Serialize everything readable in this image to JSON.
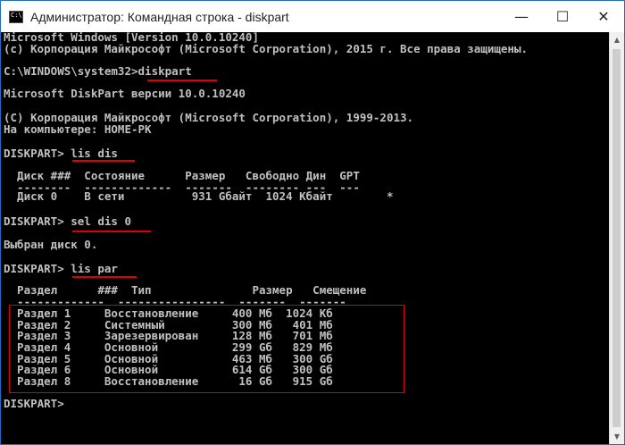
{
  "window": {
    "title": "Администратор: Командная строка - diskpart",
    "icon": "cmd-icon",
    "icon_text": "C:\\",
    "minimize": "—",
    "maximize": "☐",
    "close": "✕"
  },
  "console": {
    "lines": [
      "Microsoft Windows [Version 10.0.10240]",
      "(c) Корпорация Майкрософт (Microsoft Corporation), 2015 г. Все права защищены.",
      "",
      "C:\\WINDOWS\\system32>diskpart",
      "",
      "Microsoft DiskPart версии 10.0.10240",
      "",
      "(C) Корпорация Майкрософт (Microsoft Corporation), 1999-2013.",
      "На компьютере: HOME-PK",
      "",
      "DISKPART> lis dis",
      "",
      "  Диск ###  Состояние      Размер   Свободно Дин  GPT",
      "  --------  -------------  -------  -------- ---  ---",
      "  Диск 0    В сети          931 Gбайт  1024 Кбайт        *",
      "",
      "DISKPART> sel dis 0",
      "",
      "Выбран диск 0.",
      "",
      "DISKPART> lis par",
      "",
      "  Раздел      ###  Тип               Размер   Смещение",
      "  -------------  ----------------  -------  -------",
      "  Раздел 1     Восстановление     400 Мб  1024 Кб",
      "  Раздел 2     Системный          300 Мб   401 Мб",
      "  Раздел 3     Зарезервирован     128 Мб   701 Мб",
      "  Раздел 4     Основной           299 Gб   829 Мб",
      "  Раздел 5     Основной           463 Мб   300 Gб",
      "  Раздел 6     Основной           614 Gб   300 Gб",
      "  Раздел 8     Восстановление      16 Gб   915 Gб",
      "",
      "DISKPART>"
    ]
  },
  "colors": {
    "highlight": "#e00000",
    "console_bg": "#000000",
    "console_fg": "#c0c0c0"
  }
}
